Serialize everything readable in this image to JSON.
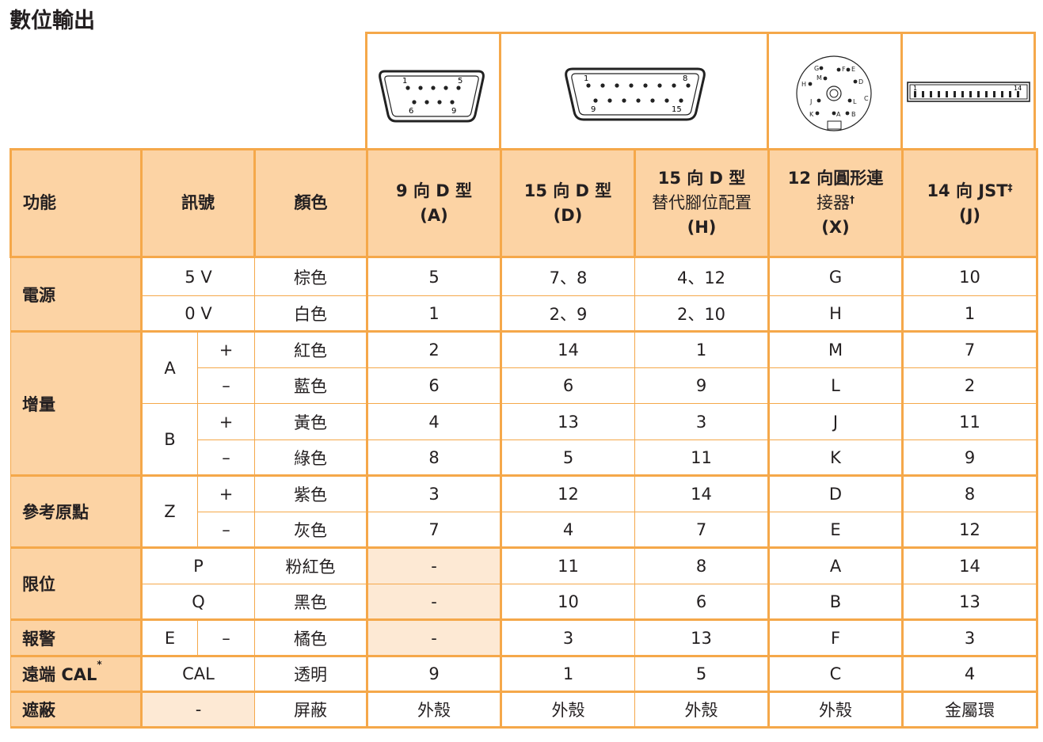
{
  "title": "數位輸出",
  "connector_labels": {
    "a_top_left": "1",
    "a_top_right": "5",
    "a_bot_left": "6",
    "a_bot_right": "9",
    "d_top_left": "1",
    "d_top_right": "8",
    "d_bot_left": "9",
    "d_bot_right": "15",
    "x_pins": [
      "G",
      "F",
      "E",
      "M",
      "D",
      "H",
      "L",
      "C",
      "J",
      "K",
      "A",
      "B"
    ],
    "j_left": "1",
    "j_right": "14"
  },
  "header": {
    "func": "功能",
    "signal": "訊號",
    "color": "顏色",
    "col_a": [
      "9 向 D 型",
      "(A)"
    ],
    "col_d": [
      "15 向 D 型",
      "(D)"
    ],
    "col_h": [
      "15 向 D 型",
      "替代腳位配置",
      "(H)"
    ],
    "col_x": [
      "12 向圓形連",
      "接器",
      "†",
      "(X)"
    ],
    "col_j": [
      "14 向 JST",
      "‡",
      "(J)"
    ]
  },
  "rows": {
    "power": {
      "func": "電源",
      "r1": {
        "signal": "5 V",
        "color": "棕色",
        "a": "5",
        "d": "7、8",
        "h": "4、12",
        "x": "G",
        "j": "10"
      },
      "r2": {
        "signal": "0 V",
        "color": "白色",
        "a": "1",
        "d": "2、9",
        "h": "2、10",
        "x": "H",
        "j": "1"
      }
    },
    "inc": {
      "func": "增量",
      "ga": "A",
      "gb": "B",
      "r1": {
        "pol": "+",
        "color": "紅色",
        "a": "2",
        "d": "14",
        "h": "1",
        "x": "M",
        "j": "7"
      },
      "r2": {
        "pol": "–",
        "color": "藍色",
        "a": "6",
        "d": "6",
        "h": "9",
        "x": "L",
        "j": "2"
      },
      "r3": {
        "pol": "+",
        "color": "黃色",
        "a": "4",
        "d": "13",
        "h": "3",
        "x": "J",
        "j": "11"
      },
      "r4": {
        "pol": "–",
        "color": "綠色",
        "a": "8",
        "d": "5",
        "h": "11",
        "x": "K",
        "j": "9"
      }
    },
    "ref": {
      "func": "參考原點",
      "g": "Z",
      "r1": {
        "pol": "+",
        "color": "紫色",
        "a": "3",
        "d": "12",
        "h": "14",
        "x": "D",
        "j": "8"
      },
      "r2": {
        "pol": "–",
        "color": "灰色",
        "a": "7",
        "d": "4",
        "h": "7",
        "x": "E",
        "j": "12"
      }
    },
    "limit": {
      "func": "限位",
      "r1": {
        "signal": "P",
        "color": "粉紅色",
        "a": "-",
        "d": "11",
        "h": "8",
        "x": "A",
        "j": "14"
      },
      "r2": {
        "signal": "Q",
        "color": "黑色",
        "a": "-",
        "d": "10",
        "h": "6",
        "x": "B",
        "j": "13"
      }
    },
    "alarm": {
      "func": "報警",
      "signal": "E",
      "pol": "–",
      "color": "橘色",
      "a": "-",
      "d": "3",
      "h": "13",
      "x": "F",
      "j": "3"
    },
    "cal": {
      "func_pre": "遠端 ",
      "func_bold": "CAL",
      "func_sup": "*",
      "signal": "CAL",
      "color": "透明",
      "a": "9",
      "d": "1",
      "h": "5",
      "x": "C",
      "j": "4"
    },
    "shield": {
      "func": "遮蔽",
      "signal": "-",
      "color": "屏蔽",
      "a": "外殼",
      "d": "外殼",
      "h": "外殼",
      "x": "外殼",
      "j": "金屬環"
    }
  }
}
